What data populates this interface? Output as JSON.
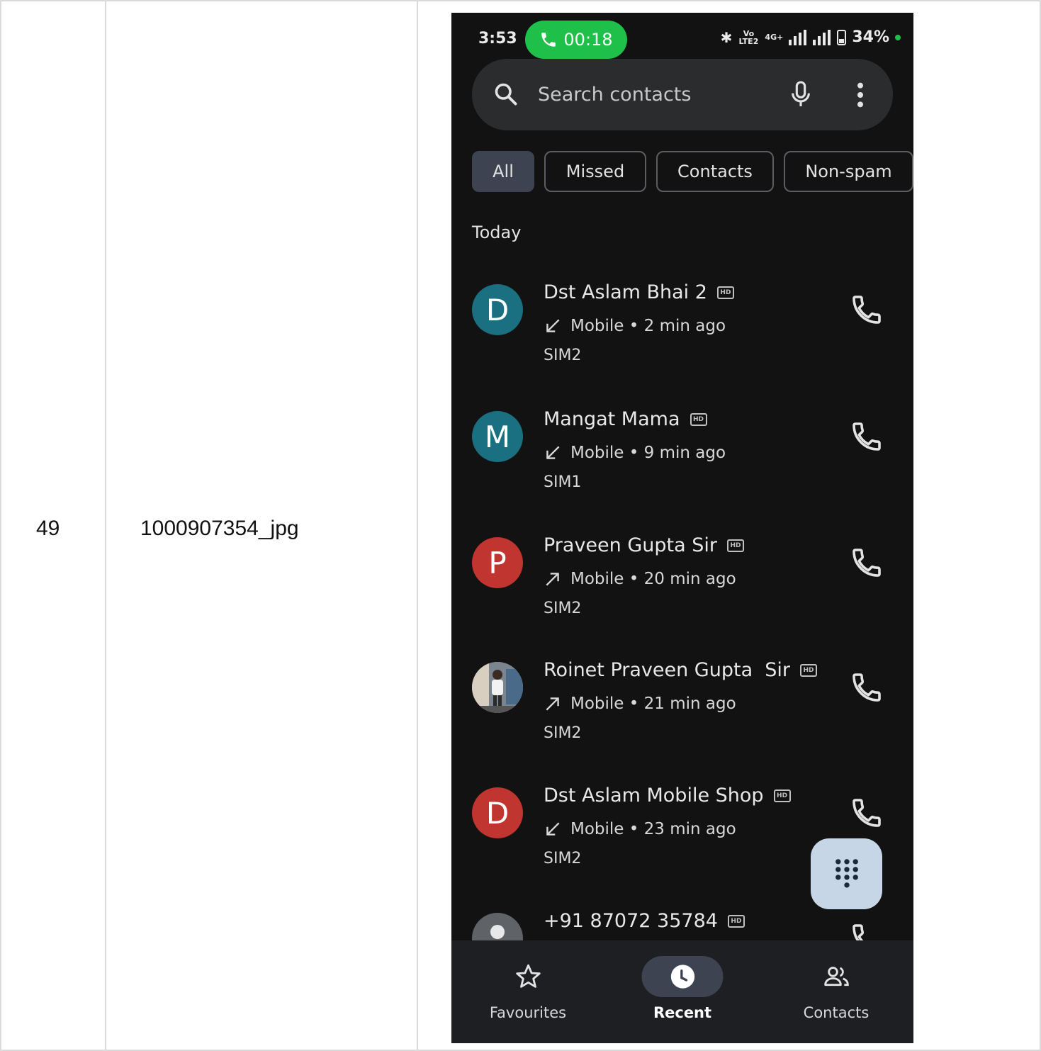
{
  "document": {
    "row_index": "49",
    "file_name": "1000907354_jpg"
  },
  "status_bar": {
    "time": "3:53",
    "call_timer": "00:18",
    "volte_label": "Vo LTE2",
    "network_label": "4G+",
    "battery": "34%"
  },
  "search": {
    "placeholder": "Search contacts"
  },
  "filters": [
    {
      "label": "All",
      "selected": true
    },
    {
      "label": "Missed",
      "selected": false
    },
    {
      "label": "Contacts",
      "selected": false
    },
    {
      "label": "Non-spam",
      "selected": false
    }
  ],
  "section_header": "Today",
  "calls": [
    {
      "initial": "D",
      "avatar_color": "#1a6f80",
      "name": "Dst Aslam Bhai 2",
      "direction": "incoming",
      "detail": "Mobile • 2 min ago",
      "sim": "SIM2"
    },
    {
      "initial": "M",
      "avatar_color": "#1a6f80",
      "name": "Mangat Mama",
      "direction": "incoming",
      "detail": "Mobile • 9 min ago",
      "sim": "SIM1"
    },
    {
      "initial": "P",
      "avatar_color": "#c0352f",
      "name": "Praveen Gupta Sir",
      "direction": "outgoing",
      "detail": "Mobile • 20 min ago",
      "sim": "SIM2"
    },
    {
      "initial": "",
      "avatar_color": "#6b6b6b",
      "name": "Roinet Praveen Gupta  Sir",
      "direction": "outgoing",
      "detail": "Mobile • 21 min ago",
      "sim": "SIM2",
      "photo": true
    },
    {
      "initial": "D",
      "avatar_color": "#c0352f",
      "name": "Dst Aslam Mobile Shop",
      "direction": "incoming",
      "detail": "Mobile • 23 min ago",
      "sim": "SIM2"
    },
    {
      "initial": "",
      "avatar_color": "#5f6368",
      "name": "+91 87072 35784",
      "direction": "",
      "detail": "",
      "sim": "",
      "unknown": true
    }
  ],
  "hd_label": "HD",
  "nav": [
    {
      "label": "Favourites",
      "icon": "star-icon",
      "active": false
    },
    {
      "label": "Recent",
      "icon": "clock-icon",
      "active": true
    },
    {
      "label": "Contacts",
      "icon": "people-icon",
      "active": false
    }
  ],
  "colors": {
    "call_pill": "#1fc04a",
    "app_background": "#121212",
    "fab": "#c7d6e6"
  }
}
